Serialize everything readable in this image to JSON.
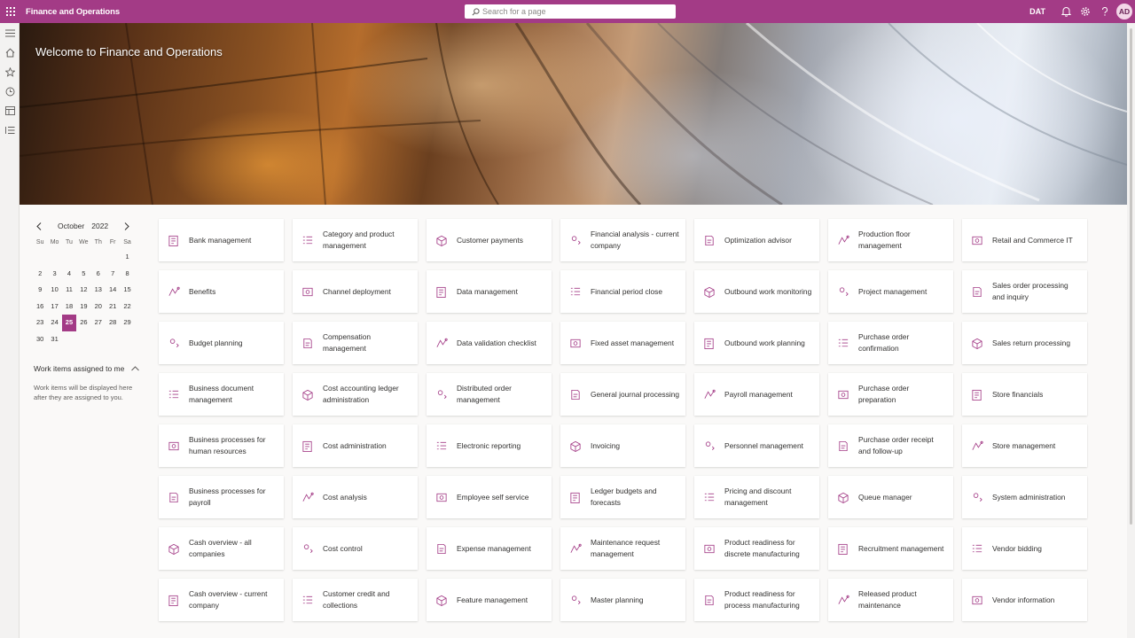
{
  "header": {
    "app_title": "Finance and Operations",
    "search_placeholder": "Search for a page",
    "company": "DAT",
    "user_initials": "AD",
    "accent_color": "#a33b86"
  },
  "nav": {
    "icons": [
      "menu-icon",
      "home-icon",
      "star-icon",
      "clock-icon",
      "workspace-icon",
      "list-icon"
    ]
  },
  "banner": {
    "title": "Welcome to Finance and Operations"
  },
  "calendar": {
    "month": "October",
    "year": "2022",
    "days_of_week": [
      "Su",
      "Mo",
      "Tu",
      "We",
      "Th",
      "Fr",
      "Sa"
    ],
    "first_weekday_index": 6,
    "days_in_month": 31,
    "selected_day": 25
  },
  "work_items": {
    "title": "Work items assigned to me",
    "description": "Work items will be displayed here after they are assigned to you."
  },
  "tiles": [
    "Bank management",
    "Category and product management",
    "Customer payments",
    "Financial analysis - current company",
    "Optimization advisor",
    "Production floor management",
    "Retail and Commerce IT",
    "Benefits",
    "Channel deployment",
    "Data management",
    "Financial period close",
    "Outbound work monitoring",
    "Project management",
    "Sales order processing and inquiry",
    "Budget planning",
    "Compensation management",
    "Data validation checklist",
    "Fixed asset management",
    "Outbound work planning",
    "Purchase order confirmation",
    "Sales return processing",
    "Business document management",
    "Cost accounting ledger administration",
    "Distributed order management",
    "General journal processing",
    "Payroll management",
    "Purchase order preparation",
    "Store financials",
    "Business processes for human resources",
    "Cost administration",
    "Electronic reporting",
    "Invoicing",
    "Personnel management",
    "Purchase order receipt and follow-up",
    "Store management",
    "Business processes for payroll",
    "Cost analysis",
    "Employee self service",
    "Ledger budgets and forecasts",
    "Pricing and discount management",
    "Queue manager",
    "System administration",
    "Cash overview - all companies",
    "Cost control",
    "Expense management",
    "Maintenance request management",
    "Product readiness for discrete manufacturing",
    "Recruitment management",
    "Vendor bidding",
    "Cash overview - current company",
    "Customer credit and collections",
    "Feature management",
    "Master planning",
    "Product readiness for process manufacturing",
    "Released product maintenance",
    "Vendor information"
  ]
}
